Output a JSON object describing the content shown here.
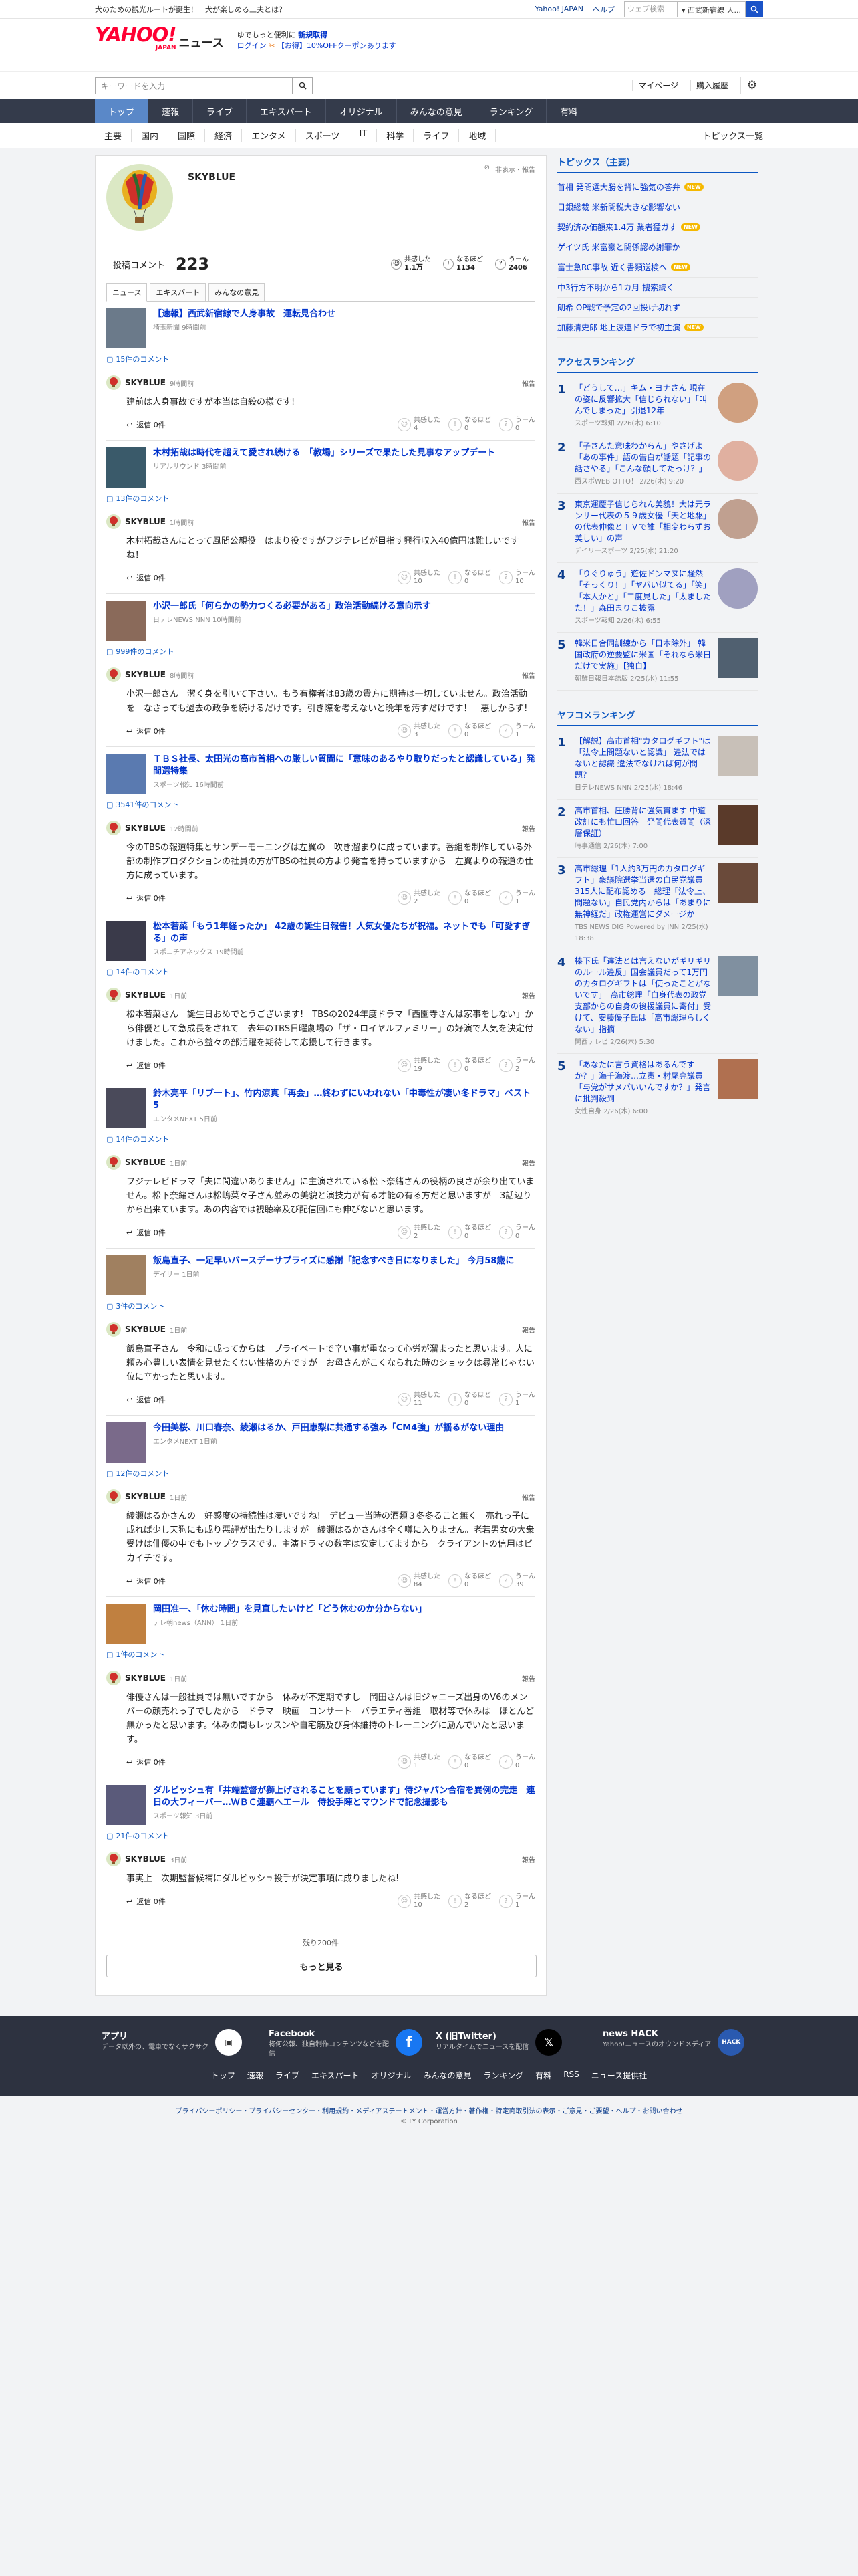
{
  "promo_bar": {
    "left": "犬のための観光ルートが誕生！　犬が楽しめる工夫とは？",
    "links": [
      "Yahoo! JAPAN",
      "ヘルプ"
    ],
    "search_placeholder": "ウェブ検索",
    "search_dropdown": "▾ 西武新宿線 人..."
  },
  "header": {
    "logo": "YAHOO!",
    "logo_sub": "JAPAN",
    "service": "ニュース",
    "promo_line1": "ゆでもっと便利に",
    "promo_bold": "新規取得",
    "promo_login": "ログイン",
    "promo_line2": "【お得】10%OFFクーポンあります"
  },
  "toolbar": {
    "keyword_placeholder": "キーワードを入力",
    "mypage": "マイページ",
    "history": "購入履歴"
  },
  "nav_primary": [
    "トップ",
    "速報",
    "ライブ",
    "エキスパート",
    "オリジナル",
    "みんなの意見",
    "ランキング",
    "有料"
  ],
  "nav_secondary": [
    "主要",
    "国内",
    "国際",
    "経済",
    "エンタメ",
    "スポーツ",
    "IT",
    "科学",
    "ライフ",
    "地域"
  ],
  "nav_secondary_right": "トピックス一覧",
  "profile": {
    "name": "SKYBLUE",
    "report": "非表示・報告",
    "comments_label": "投稿コメント",
    "comments_count": "223",
    "reactions": [
      {
        "label": "共感した",
        "value": "1.1万"
      },
      {
        "label": "なるほど",
        "value": "1134"
      },
      {
        "label": "うーん",
        "value": "2406"
      }
    ]
  },
  "tabs": [
    "ニュース",
    "エキスパート",
    "みんなの意見"
  ],
  "items": [
    {
      "title": "【速報】西武新宿線で人身事故　運転見合わせ",
      "source": "埼玉新聞",
      "time": "9時間前",
      "comment_count": "15件のコメント",
      "author": "SKYBLUE",
      "ctime": "9時間前",
      "body": "建前は人身事故ですが本当は自殺の様です!",
      "reply": "返信 0件",
      "r": [
        "4",
        "0",
        "0"
      ]
    },
    {
      "title": "木村拓哉は時代を超えて愛され続ける　「教場」シリーズで果たした見事なアップデート",
      "source": "リアルサウンド",
      "time": "3時間前",
      "comment_count": "13件のコメント",
      "author": "SKYBLUE",
      "ctime": "1時間前",
      "body": "木村拓哉さんにとって風間公親役　はまり役ですがフジテレビが目指す興行収入40億円は難しいですね！",
      "reply": "返信 0件",
      "r": [
        "10",
        "0",
        "10"
      ]
    },
    {
      "title": "小沢一郎氏「何らかの勢力つくる必要がある」政治活動続ける意向示す",
      "source": "日テレNEWS NNN",
      "time": "10時間前",
      "comment_count": "999件のコメント",
      "author": "SKYBLUE",
      "ctime": "8時間前",
      "body": "小沢一郎さん　潔く身を引いて下さい。もう有権者は83歳の貴方に期待は一切していません。政治活動を　なさっても過去の政争を続けるだけです。引き際を考えないと晩年を汚すだけです！　悪しからず!",
      "reply": "返信 0件",
      "r": [
        "3",
        "0",
        "1"
      ]
    },
    {
      "title": "ＴＢＳ社長、太田光の高市首相への厳しい質問に「意味のあるやり取りだったと認識している」発問選特集",
      "source": "スポーツ報知",
      "time": "16時間前",
      "comment_count": "3541件のコメント",
      "author": "SKYBLUE",
      "ctime": "12時間前",
      "body": "今のTBSの報道特集とサンデーモーニングは左翼の　吹き溜まりに成っています。番組を制作している外部の制作プロダクションの社員の方がTBSの社員の方より発言を持っていますから　左翼よりの報道の仕方に成っています。",
      "reply": "返信 0件",
      "r": [
        "2",
        "0",
        "1"
      ]
    },
    {
      "title": "松本若菜「もう1年経ったか」 42歳の誕生日報告！人気女優たちが祝福。ネットでも「可愛すぎる」の声",
      "source": "スポニチアネックス",
      "time": "19時間前",
      "comment_count": "14件のコメント",
      "author": "SKYBLUE",
      "ctime": "1日前",
      "body": "松本若菜さん　誕生日おめでとうございます!　TBSの2024年度ドラマ「西園寺さんは家事をしない」から俳優として急成長をされて　去年のTBS日曜劇場の「ザ・ロイヤルファミリー」の好演で人気を決定付けました。これから益々の部活躍を期待して応援して行きます。",
      "reply": "返信 0件",
      "r": [
        "19",
        "0",
        "2"
      ]
    },
    {
      "title": "鈴木亮平「リブート」、竹内涼真「再会」…終わずにいわれない「中毒性が凄い冬ドラマ」ベスト5",
      "source": "エンタメNEXT",
      "time": "5日前",
      "comment_count": "14件のコメント",
      "author": "SKYBLUE",
      "ctime": "1日前",
      "body": "フジテレビドラマ「夫に間違いありません」に主演されている松下奈緒さんの役柄の良さが余り出ていません。松下奈緒さんは松嶋菜々子さん並みの美貌と演技力が有る才能の有る方だと思いますが　3話辺りから出来ています。あの内容では視聴率及び配信回にも伸びないと思います。",
      "reply": "返信 0件",
      "r": [
        "2",
        "0",
        "0"
      ]
    },
    {
      "title": "飯島直子、一足早いバースデーサプライズに感謝「記念すべき日になりました」 今月58歳に",
      "source": "デイリー",
      "time": "1日前",
      "comment_count": "3件のコメント",
      "author": "SKYBLUE",
      "ctime": "1日前",
      "body": "飯島直子さん　令和に成ってからは　プライベートで辛い事が重なって心労が溜まったと思います。人に頼み心豊しい表情を見せたくない性格の方ですが　お母さんがこくなられた時のショックは尋常じゃない位に辛かったと思います。",
      "reply": "返信 0件",
      "r": [
        "11",
        "0",
        "1"
      ]
    },
    {
      "title": "今田美桜、川口春奈、綾瀬はるか、戸田恵梨に共通する強み「CM4強」が揺るがない理由",
      "source": "エンタメNEXT",
      "time": "1日前",
      "comment_count": "12件のコメント",
      "author": "SKYBLUE",
      "ctime": "1日前",
      "body": "綾瀬はるかさんの　好感度の持続性は凄いですね!　デビュー当時の酒類３冬冬ること無く　売れっ子に成れば少し天狗にも成り悪評が出たりしますが　綾瀬はるかさんは全く噂に入りません。老若男女の大衆受けは俳優の中でもトップクラスです。主演ドラマの数字は安定してますから　クライアントの信用はピカイチです。",
      "reply": "返信 0件",
      "r": [
        "84",
        "0",
        "39"
      ]
    },
    {
      "title": "岡田准一、「休む時間」を見直したいけど「どう休むのか分からない」",
      "source": "テレ朝news（ANN）",
      "time": "1日前",
      "comment_count": "1件のコメント",
      "author": "SKYBLUE",
      "ctime": "1日前",
      "body": "俳優さんは一般社員では無いですから　休みが不定期ですし　岡田さんは旧ジャニーズ出身のV6のメンバーの顔売れっ子でしたから　ドラマ　映画　コンサート　バラエティ番組　取材等で休みは　ほとんど無かったと思います。休みの間もレッスンや自宅筋及び身体維持のトレーニングに励んでいたと思います。",
      "reply": "返信 0件",
      "r": [
        "1",
        "0",
        "0"
      ]
    },
    {
      "title": "ダルビッシュ有「井端監督が獅上げされることを願っています」侍ジャパン合宿を異例の完走　連日の大フィーバー…ＷＢＣ連覇へエール　侍投手陣とマウンドで記念撮影も",
      "source": "スポーツ報知",
      "time": "3日前",
      "comment_count": "21件のコメント",
      "author": "SKYBLUE",
      "ctime": "3日前",
      "body": "事実上　次期監督候補にダルビッシュ投手が決定事項に成りましたね!",
      "reply": "返信 0件",
      "r": [
        "10",
        "2",
        "1"
      ]
    }
  ],
  "more": {
    "remaining": "残り200件",
    "button": "もっと見る"
  },
  "reaction_labels": [
    "共感した",
    "なるほど",
    "うーん"
  ],
  "report_label": "報告",
  "sidebar": {
    "topics_title": "トピックス（主要）",
    "topics": [
      {
        "t": "首相 発問選大勝を背に強気の答弁",
        "n": true
      },
      {
        "t": "日銀総裁 米新関税大きな影響ない",
        "n": false
      },
      {
        "t": "契約済み価額来1.4万 業者猛ガす",
        "n": true
      },
      {
        "t": "ゲイツ氏 米富豪と関係認め謝罪か",
        "n": false
      },
      {
        "t": "富士急RC事故 近く書類送検へ",
        "n": true
      },
      {
        "t": "中3行方不明から1カ月 捜索続く",
        "n": false
      },
      {
        "t": "朗希 OP戦で予定の2回投げ切れず",
        "n": false
      },
      {
        "t": "加藤清史郎 地上波連ドラで初主演",
        "n": true
      }
    ],
    "access_title": "アクセスランキング",
    "access": [
      {
        "t": "「どうして…」キム・ヨナさん 現在の姿に反響拡大「信じられない」「叫んでしまった」引退12年",
        "s": "スポーツ報知 2/26(木) 6:10"
      },
      {
        "t": "「子さんた意味わからん」やさげよ「あの事件」語の告白が話題「記事の話さやる」「こんな顔してたっけ？」",
        "s": "西スポWEB OTTO！ 2/26(木) 9:20"
      },
      {
        "t": "東京運慶子信じられん美貌！大は元ランサー代表の５９歳女優「天と地駆」の代表伸像とＴＶで誰「相変わらずお美しい」の声",
        "s": "デイリースポーツ 2/25(水) 21:20"
      },
      {
        "t": "「りぐりゅう」遊佐ドンマヌに騒然「そっくり！」「ヤバい似てる」「笑」「本人かと」「二度見した」「太ましたた！」森田まりこ披露",
        "s": "スポーツ報知 2/26(木) 6:55"
      },
      {
        "t": "韓米日合同訓練から「日本除外」 韓国政府の逆要監に米国「それなら米日だけで実施」【独自】",
        "s": "朝鮮日報日本語版 2/25(水) 11:55"
      }
    ],
    "yafoo_title": "ヤフコメランキング",
    "yafoo": [
      {
        "t": "【解説】高市首相\"カタログギフト\"は「法令上問題ないと認識」 違法ではないと認識 違法でなければ何が問題？",
        "s": "日テレNEWS NNN 2/25(水) 18:46"
      },
      {
        "t": "高市首相、圧勝背に強気貫ます 中道改訂にも忙口回答　発問代表質問（深層保証）",
        "s": "時事通信 2/26(木) 7:00"
      },
      {
        "t": "高市総理「1人約3万円のカタログギフト」衆議院選挙当選の自民党議員315人に配布認める　総理「法令上、問題ない」自民党内からは「あまりに無神経だ」政権運営にダメージか",
        "s": "TBS NEWS DIG Powered by JNN 2/25(水) 18:38"
      },
      {
        "t": "榛下氏「違法とは言えないがギリギリのルール違反」国会議員だって1万円のカタログギフトは「使ったことがないです」　高市総理「自身代表の政党支部からの自身の後援議員に寄付」受けて、安藤優子氏は「高市総理らしくない」指摘",
        "s": "関西テレビ 2/26(木) 5:30"
      },
      {
        "t": "「あなたに言う資格はあるんですか？」海千海渡…立憲・村尾亮議員「与党がサメバいいんですか？」発言に批判殺到",
        "s": "女性自身 2/26(木) 6:00"
      }
    ]
  },
  "footer": {
    "apps": [
      {
        "t": "アプリ",
        "d": "データ以外の、電車でなくサクサク",
        "icon": "app"
      },
      {
        "t": "Facebook",
        "d": "将何公報、独自制作コンテンツなどを配信",
        "icon": "f"
      },
      {
        "t": "X (旧Twitter)",
        "d": "リアルタイムでニュースを配信",
        "icon": "X"
      },
      {
        "t": "news HACK",
        "d": "Yahoo!ニュースのオウンドメディア",
        "icon": "HACK"
      }
    ],
    "nav": [
      "トップ",
      "速報",
      "ライブ",
      "エキスパート",
      "オリジナル",
      "みんなの意見",
      "ランキング",
      "有料",
      "RSS",
      "ニュース提供社"
    ],
    "legal": "プライバシーポリシー・プライバシーセンター・利用規約・メディアステートメント・運営方針・著作権・特定商取引法の表示・ご意見・ご要望・ヘルプ・お問い合わせ",
    "copyright": "© LY Corporation"
  }
}
